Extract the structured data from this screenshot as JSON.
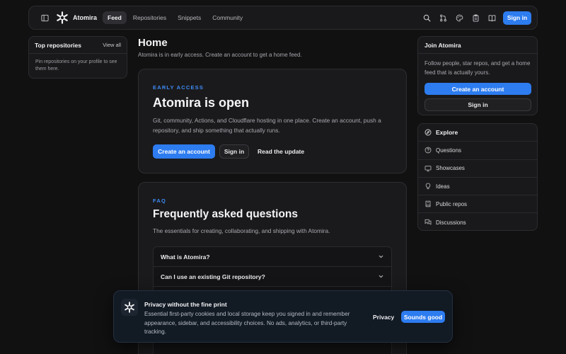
{
  "topbar": {
    "brand": "Atomira",
    "nav": [
      "Feed",
      "Repositories",
      "Snippets",
      "Community"
    ],
    "signin": "Sign in"
  },
  "left": {
    "title": "Top repositories",
    "link": "View all",
    "body": "Pin repositories on your profile to see them here."
  },
  "main": {
    "title": "Home",
    "subtitle": "Atomira is in early access. Create an account to get a home feed.",
    "hero": {
      "eyebrow": "EARLY ACCESS",
      "title": "Atomira is open",
      "text": "Git, community, Actions, and Cloudflare hosting in one place. Create an account, push a repository, and ship something that actually runs.",
      "create": "Create an account",
      "signin": "Sign in",
      "read": "Read the update"
    },
    "faq": {
      "eyebrow": "FAQ",
      "title": "Frequently asked questions",
      "text": "The essentials for creating, collaborating, and shipping with Atomira.",
      "items": [
        "What is Atomira?",
        "Can I use an existing Git repository?"
      ]
    }
  },
  "join": {
    "title": "Join Atomira",
    "text": "Follow people, star repos, and get a home feed that is actually yours.",
    "create": "Create an account",
    "signin": "Sign in"
  },
  "explore": {
    "title": "Explore",
    "items": [
      {
        "label": "Questions",
        "icon": "question-icon"
      },
      {
        "label": "Showcases",
        "icon": "monitor-icon"
      },
      {
        "label": "Ideas",
        "icon": "lightbulb-icon"
      },
      {
        "label": "Public repos",
        "icon": "book-icon"
      },
      {
        "label": "Discussions",
        "icon": "chat-icon"
      }
    ]
  },
  "cookie": {
    "title": "Privacy without the fine print",
    "body": "Essential first-party cookies and local storage keep you signed in and remember appearance, sidebar, and accessibility choices. No ads, analytics, or third-party tracking.",
    "privacy": "Privacy",
    "ok": "Sounds good"
  },
  "colors": {
    "accent": "#2d7cf0",
    "eyebrow": "#3f8bf5",
    "background": "#111112"
  }
}
